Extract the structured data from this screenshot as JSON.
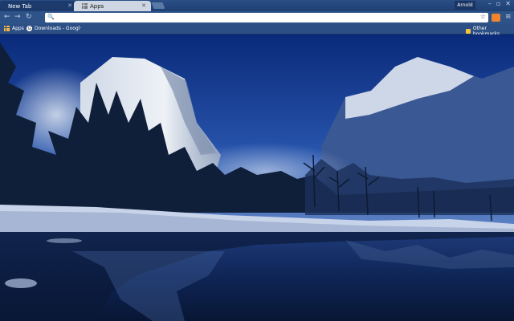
{
  "tabs": [
    {
      "label": "New Tab",
      "active": false
    },
    {
      "label": "Apps",
      "active": true
    }
  ],
  "user": {
    "name": "Arnold"
  },
  "toolbar": {
    "back_icon": "back-arrow-icon",
    "forward_icon": "forward-arrow-icon",
    "reload_icon": "reload-icon",
    "omnibox_value": "",
    "star_icon": "star-icon"
  },
  "bookmarks": {
    "items": [
      {
        "label": "Apps",
        "icon": "apps-grid-icon"
      },
      {
        "label": "Downloads - Googl·",
        "icon": "google-g-icon"
      }
    ],
    "other": {
      "label": "Other bookmarks",
      "icon": "folder-icon"
    }
  },
  "colors": {
    "accent": "#2e5389",
    "ext": "#f2842b"
  }
}
